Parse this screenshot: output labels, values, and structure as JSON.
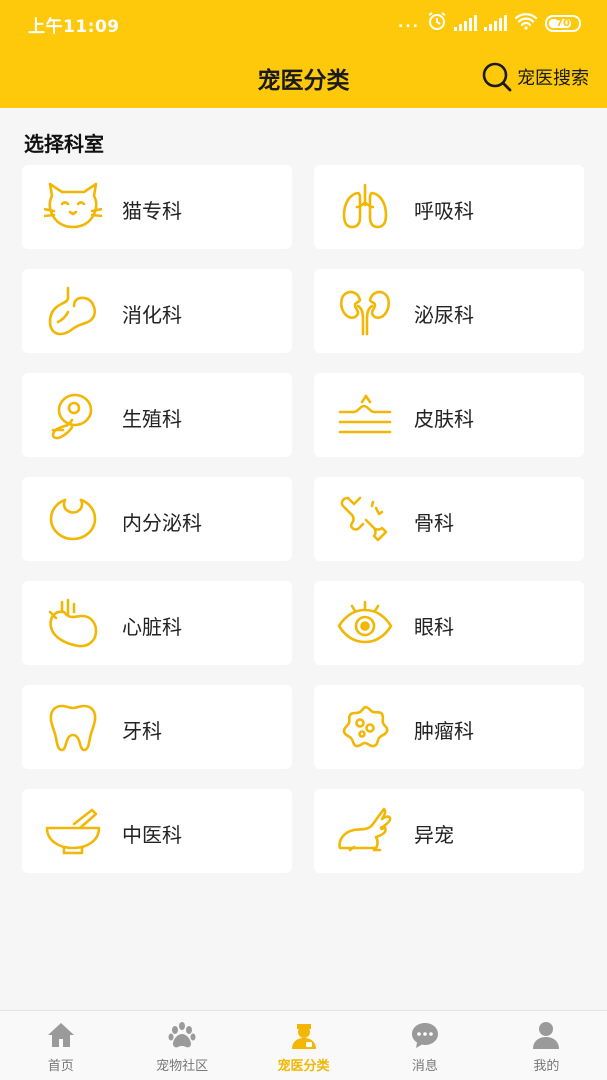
{
  "status_bar": {
    "time": "上午11:09",
    "dots": "...",
    "battery": "70"
  },
  "header": {
    "title": "宠医分类",
    "search_label": "宠医搜索"
  },
  "section": {
    "title": "选择科室"
  },
  "departments": [
    {
      "label": "猫专科",
      "icon": "cat-icon"
    },
    {
      "label": "呼吸科",
      "icon": "lungs-icon"
    },
    {
      "label": "消化科",
      "icon": "stomach-icon"
    },
    {
      "label": "泌尿科",
      "icon": "kidney-icon"
    },
    {
      "label": "生殖科",
      "icon": "reproductive-icon"
    },
    {
      "label": "皮肤科",
      "icon": "skin-icon"
    },
    {
      "label": "内分泌科",
      "icon": "endocrine-icon"
    },
    {
      "label": "骨科",
      "icon": "bone-icon"
    },
    {
      "label": "心脏科",
      "icon": "heart-icon"
    },
    {
      "label": "眼科",
      "icon": "eye-icon"
    },
    {
      "label": "牙科",
      "icon": "tooth-icon"
    },
    {
      "label": "肿瘤科",
      "icon": "tumor-icon"
    },
    {
      "label": "中医科",
      "icon": "mortar-icon"
    },
    {
      "label": "异宠",
      "icon": "rabbit-icon"
    }
  ],
  "tabs": [
    {
      "label": "首页",
      "icon": "home-icon",
      "active": false
    },
    {
      "label": "宠物社区",
      "icon": "paw-icon",
      "active": false
    },
    {
      "label": "宠医分类",
      "icon": "doctor-icon",
      "active": true
    },
    {
      "label": "消息",
      "icon": "chat-bubble-icon",
      "active": false
    },
    {
      "label": "我的",
      "icon": "person-icon",
      "active": false
    }
  ],
  "colors": {
    "brand": "#fdc90a",
    "icon": "#f2b705",
    "tab_active": "#f2b705",
    "tab_inactive": "#9a9a9a"
  }
}
